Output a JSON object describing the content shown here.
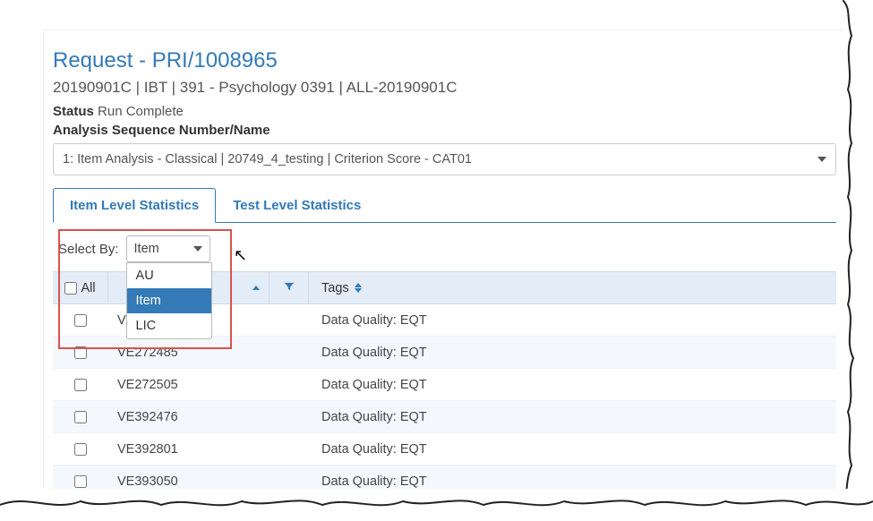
{
  "title": "Request - PRI/1008965",
  "subtitle": "20190901C | IBT | 391 - Psychology 0391 | ALL-20190901C",
  "status_label": "Status",
  "status_value": "Run Complete",
  "sequence_label": "Analysis Sequence Number/Name",
  "sequence_value": "1: Item Analysis - Classical | 20749_4_testing | Criterion Score - CAT01",
  "tabs": {
    "item_level": "Item Level Statistics",
    "test_level": "Test Level Statistics"
  },
  "select_by_label": "Select By:",
  "select_by_value": "Item",
  "select_by_options": [
    "AU",
    "Item",
    "LIC"
  ],
  "headers": {
    "all": "All",
    "tags": "Tags"
  },
  "rows": [
    {
      "id": "VE272443",
      "tags": "Data Quality: EQT",
      "alt": false
    },
    {
      "id": "VE272485",
      "tags": "Data Quality: EQT",
      "alt": true
    },
    {
      "id": "VE272505",
      "tags": "Data Quality: EQT",
      "alt": false
    },
    {
      "id": "VE392476",
      "tags": "Data Quality: EQT",
      "alt": true
    },
    {
      "id": "VE392801",
      "tags": "Data Quality: EQT",
      "alt": false
    },
    {
      "id": "VE393050",
      "tags": "Data Quality: EQT",
      "alt": true
    }
  ]
}
